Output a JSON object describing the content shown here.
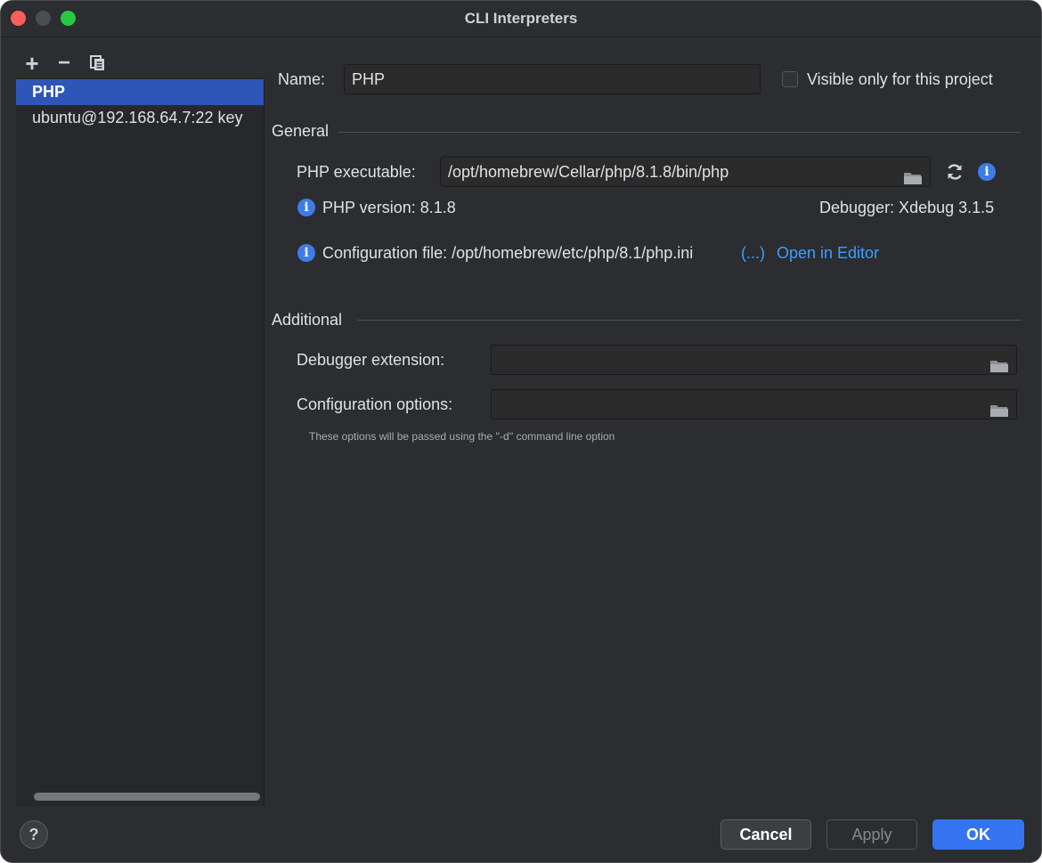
{
  "window": {
    "title": "CLI Interpreters"
  },
  "sidebar": {
    "toolbar": {
      "add_label": "+",
      "remove_label": "−",
      "copy_icon": "copy-icon"
    },
    "items": [
      {
        "label": "PHP",
        "selected": true
      },
      {
        "label": "ubuntu@192.168.64.7:22 key",
        "selected": false
      }
    ]
  },
  "form": {
    "name_label": "Name:",
    "name_value": "PHP",
    "visible_only_label": "Visible only for this project",
    "visible_only_checked": false,
    "general_section": "General",
    "php_executable_label": "PHP executable:",
    "php_executable_value": "/opt/homebrew/Cellar/php/8.1.8/bin/php",
    "php_version_text": "PHP version: 8.1.8",
    "debugger_text": "Debugger:  Xdebug 3.1.5",
    "config_file_text": "Configuration file: /opt/homebrew/etc/php/8.1/php.ini",
    "config_file_more": "(...)",
    "open_in_editor": "Open in Editor",
    "additional_section": "Additional",
    "debugger_extension_label": "Debugger extension:",
    "debugger_extension_value": "",
    "config_options_label": "Configuration options:",
    "config_options_value": "",
    "config_options_hint": "These options will be passed using the ''-d'' command line option"
  },
  "footer": {
    "help_label": "?",
    "cancel_label": "Cancel",
    "apply_label": "Apply",
    "ok_label": "OK"
  },
  "colors": {
    "accent": "#3574f0",
    "selection": "#2e55b8",
    "link": "#3c9eff",
    "info": "#3d7ce8"
  }
}
